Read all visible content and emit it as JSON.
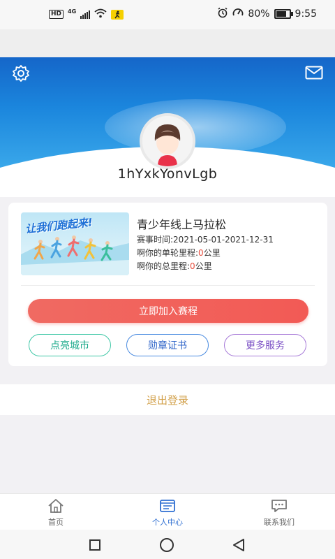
{
  "status_bar": {
    "hd_label": "HD",
    "network": "4G",
    "battery": "80%",
    "time": "9:55"
  },
  "profile": {
    "username": "1hYxkYonvLgb"
  },
  "event": {
    "banner_text": "让我们跑起来!",
    "title": "青少年线上马拉松",
    "date_label": "赛事时间:",
    "date_value": "2021-05-01-2021-12-31",
    "single_label": "啊你的单轮里程:",
    "single_value": "0",
    "total_label": "啊你的总里程:",
    "total_value": "0",
    "unit": "公里"
  },
  "actions": {
    "join": "立即加入赛程",
    "light_city": "点亮城市",
    "medal_cert": "勋章证书",
    "more_services": "更多服务"
  },
  "logout": "退出登录",
  "tabs": [
    {
      "label": "首页",
      "icon": "home-icon"
    },
    {
      "label": "个人中心",
      "icon": "profile-card-icon"
    },
    {
      "label": "联系我们",
      "icon": "chat-icon"
    }
  ],
  "active_tab": "个人中心",
  "colors": {
    "header_blue": "#1b86dd",
    "join_red": "#f25a55",
    "logout_gold": "#d2a04a",
    "active_tab": "#2f6fd2"
  }
}
